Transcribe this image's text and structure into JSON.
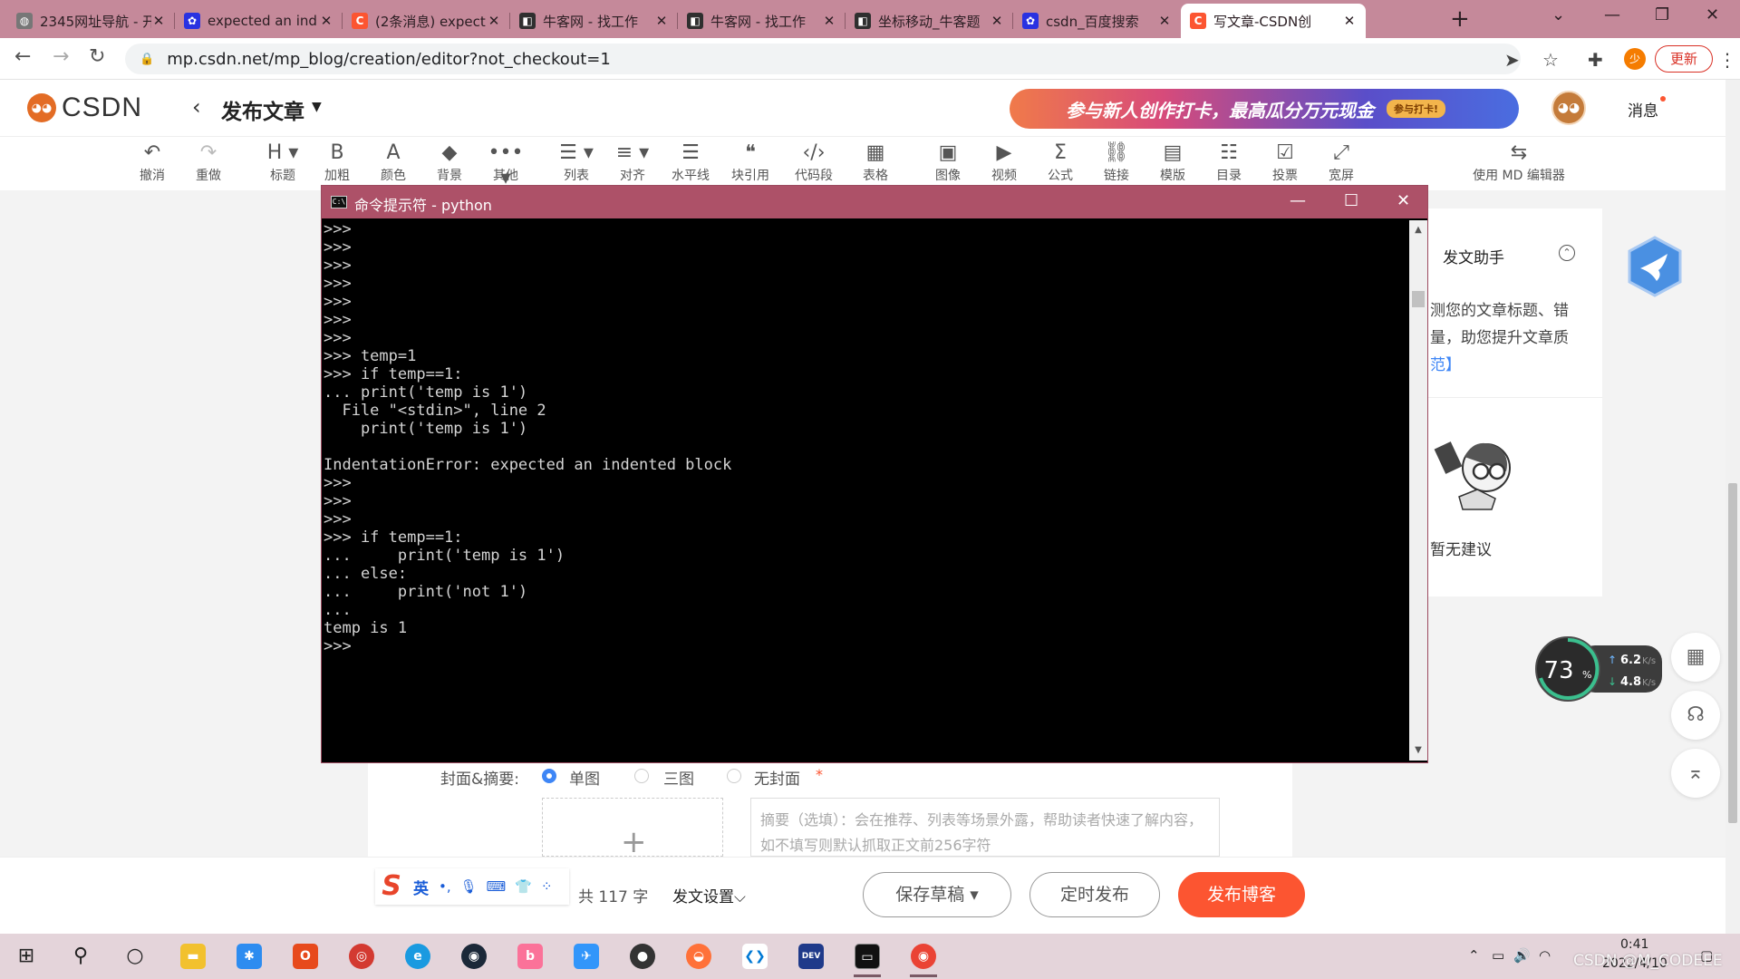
{
  "browser": {
    "tabs": [
      {
        "title": "2345网址导航 - 开",
        "icon": "globe-icon",
        "icon_color": "#777777"
      },
      {
        "title": "expected an ind",
        "icon": "baidu-paw-icon",
        "icon_color": "#2932e1"
      },
      {
        "title": "(2条消息) expect",
        "icon": "csdn-icon",
        "icon_color": "#fc5531"
      },
      {
        "title": "牛客网 - 找工作",
        "icon": "nowcoder-icon",
        "icon_color": "#2f2f2f"
      },
      {
        "title": "牛客网 - 找工作",
        "icon": "nowcoder-icon",
        "icon_color": "#2f2f2f"
      },
      {
        "title": "坐标移动_牛客题",
        "icon": "nowcoder-icon",
        "icon_color": "#2f2f2f"
      },
      {
        "title": "csdn_百度搜索",
        "icon": "baidu-paw-icon",
        "icon_color": "#2932e1"
      },
      {
        "title": "写文章-CSDN创",
        "icon": "csdn-icon",
        "icon_color": "#fc5531",
        "active": true
      }
    ],
    "url": "mp.csdn.net/mp_blog/creation/editor?not_checkout=1",
    "update_label": "更新",
    "profile_initial": "少"
  },
  "header": {
    "logo_text": "CSDN",
    "page_title": "发布文章",
    "banner_text": "参与新人创作打卡，最高瓜分万元现金",
    "banner_pill": "参与打卡!",
    "messages_label": "消息"
  },
  "toolbar": [
    {
      "label": "撤消",
      "icon": "undo-icon",
      "glyph": "↶"
    },
    {
      "label": "重做",
      "icon": "redo-icon",
      "glyph": "↷"
    },
    {
      "label": "标题",
      "icon": "heading-icon",
      "glyph": "H ▾"
    },
    {
      "label": "加粗",
      "icon": "bold-icon",
      "glyph": "B"
    },
    {
      "label": "颜色",
      "icon": "text-color-icon",
      "glyph": "A"
    },
    {
      "label": "背景",
      "icon": "paint-bucket-icon",
      "glyph": "◆"
    },
    {
      "label": "其他",
      "icon": "more-icon",
      "glyph": "••• ▾"
    },
    {
      "label": "列表",
      "icon": "list-icon",
      "glyph": "☰ ▾"
    },
    {
      "label": "对齐",
      "icon": "align-icon",
      "glyph": "≡ ▾"
    },
    {
      "label": "水平线",
      "icon": "horizontal-rule-icon",
      "glyph": "☰"
    },
    {
      "label": "块引用",
      "icon": "quote-icon",
      "glyph": "❝"
    },
    {
      "label": "代码段",
      "icon": "code-icon",
      "glyph": "‹/›"
    },
    {
      "label": "表格",
      "icon": "table-icon",
      "glyph": "▦"
    },
    {
      "label": "图像",
      "icon": "image-icon",
      "glyph": "▣"
    },
    {
      "label": "视频",
      "icon": "video-icon",
      "glyph": "▶"
    },
    {
      "label": "公式",
      "icon": "formula-icon",
      "glyph": "Σ"
    },
    {
      "label": "链接",
      "icon": "link-icon",
      "glyph": "⛓"
    },
    {
      "label": "模版",
      "icon": "template-icon",
      "glyph": "▤"
    },
    {
      "label": "目录",
      "icon": "toc-icon",
      "glyph": "☷"
    },
    {
      "label": "投票",
      "icon": "vote-icon",
      "glyph": "☑"
    },
    {
      "label": "宽屏",
      "icon": "widescreen-icon",
      "glyph": "⤢"
    },
    {
      "label": "使用 MD 编辑器",
      "icon": "switch-editor-icon",
      "glyph": "⇆"
    }
  ],
  "terminal": {
    "title": "命令提示符 - python",
    "lines": [
      ">>>",
      ">>>",
      ">>>",
      ">>>",
      ">>>",
      ">>>",
      ">>>",
      ">>> temp=1",
      ">>> if temp==1:",
      "... print('temp is 1')",
      "  File \"<stdin>\", line 2",
      "    print('temp is 1')",
      "",
      "IndentationError: expected an indented block",
      ">>>",
      ">>>",
      ">>>",
      ">>> if temp==1:",
      "...     print('temp is 1')",
      "... else:",
      "...     print('not 1')",
      "...",
      "temp is 1",
      ">>>"
    ]
  },
  "editor": {
    "cover_label": "封面&摘要:",
    "cover_options": [
      {
        "label": "单图",
        "selected": true
      },
      {
        "label": "三图",
        "selected": false
      },
      {
        "label": "无封面",
        "selected": false
      }
    ],
    "required_mark": "*",
    "upload_plus": "+",
    "summary_placeholder": "摘要（选填）：会在推荐、列表等场景外露，帮助读者快速了解内容，如不填写则默认抓取正文前256字符"
  },
  "assistant": {
    "title": "发文助手",
    "desc_line1": "测您的文章标题、错",
    "desc_line2": "量，助您提升文章质",
    "desc_link": "范】",
    "empty_text": "暂无建议"
  },
  "netmon": {
    "percent": "73",
    "percent_unit": "%",
    "up": "6.2",
    "down": "4.8",
    "unit": "K/s"
  },
  "bottom": {
    "ime_lang": "英",
    "word_count": "共 117 字",
    "publish_settings": "发文设置",
    "save_draft": "保存草稿",
    "schedule": "定时发布",
    "publish": "发布博客"
  },
  "taskbar": {
    "time": "0:41",
    "date": "2022/4/10",
    "watermark": "CSDN @M_CODEEE"
  }
}
